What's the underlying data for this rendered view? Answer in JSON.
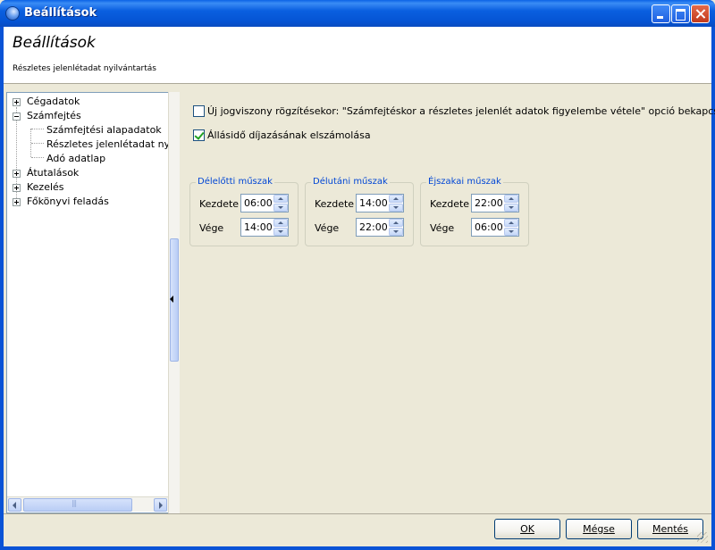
{
  "window": {
    "title": "Beállítások"
  },
  "header": {
    "title": "Beállítások",
    "subtitle": "Részletes jelenlétadat nyilvántartás"
  },
  "tree": {
    "items": [
      {
        "label": "Cégadatok",
        "expander": "plus"
      },
      {
        "label": "Számfejtés",
        "expander": "minus"
      },
      {
        "label": "Számfejtési alapadatok"
      },
      {
        "label": "Részletes jelenlétadat nyilvá"
      },
      {
        "label": "Adó adatlap"
      },
      {
        "label": "Átutalások",
        "expander": "plus"
      },
      {
        "label": "Kezelés",
        "expander": "plus"
      },
      {
        "label": "Főkönyvi feladás",
        "expander": "plus"
      }
    ]
  },
  "options": {
    "new_employment": {
      "label": "Új jogviszony rögzítésekor: \"Számfejtéskor a részletes jelenlét adatok figyelembe vétele\" opció bekapcsolása",
      "checked": false
    },
    "standby_pay": {
      "label": "Állásidő díjazásának elszámolása",
      "checked": true
    }
  },
  "shifts": [
    {
      "title": "Délelőtti műszak",
      "start_label": "Kezdete",
      "start": "06:00",
      "end_label": "Vége",
      "end": "14:00"
    },
    {
      "title": "Délutáni műszak",
      "start_label": "Kezdete",
      "start": "14:00",
      "end_label": "Vége",
      "end": "22:00"
    },
    {
      "title": "Éjszakai műszak",
      "start_label": "Kezdete",
      "start": "22:00",
      "end_label": "Vége",
      "end": "06:00"
    }
  ],
  "buttons": {
    "ok": "OK",
    "cancel": "Mégse",
    "save": "Mentés"
  },
  "icons": {
    "app": "app-globe-icon",
    "minimize": "minimize-icon",
    "maximize": "maximize-icon",
    "close": "close-icon"
  }
}
